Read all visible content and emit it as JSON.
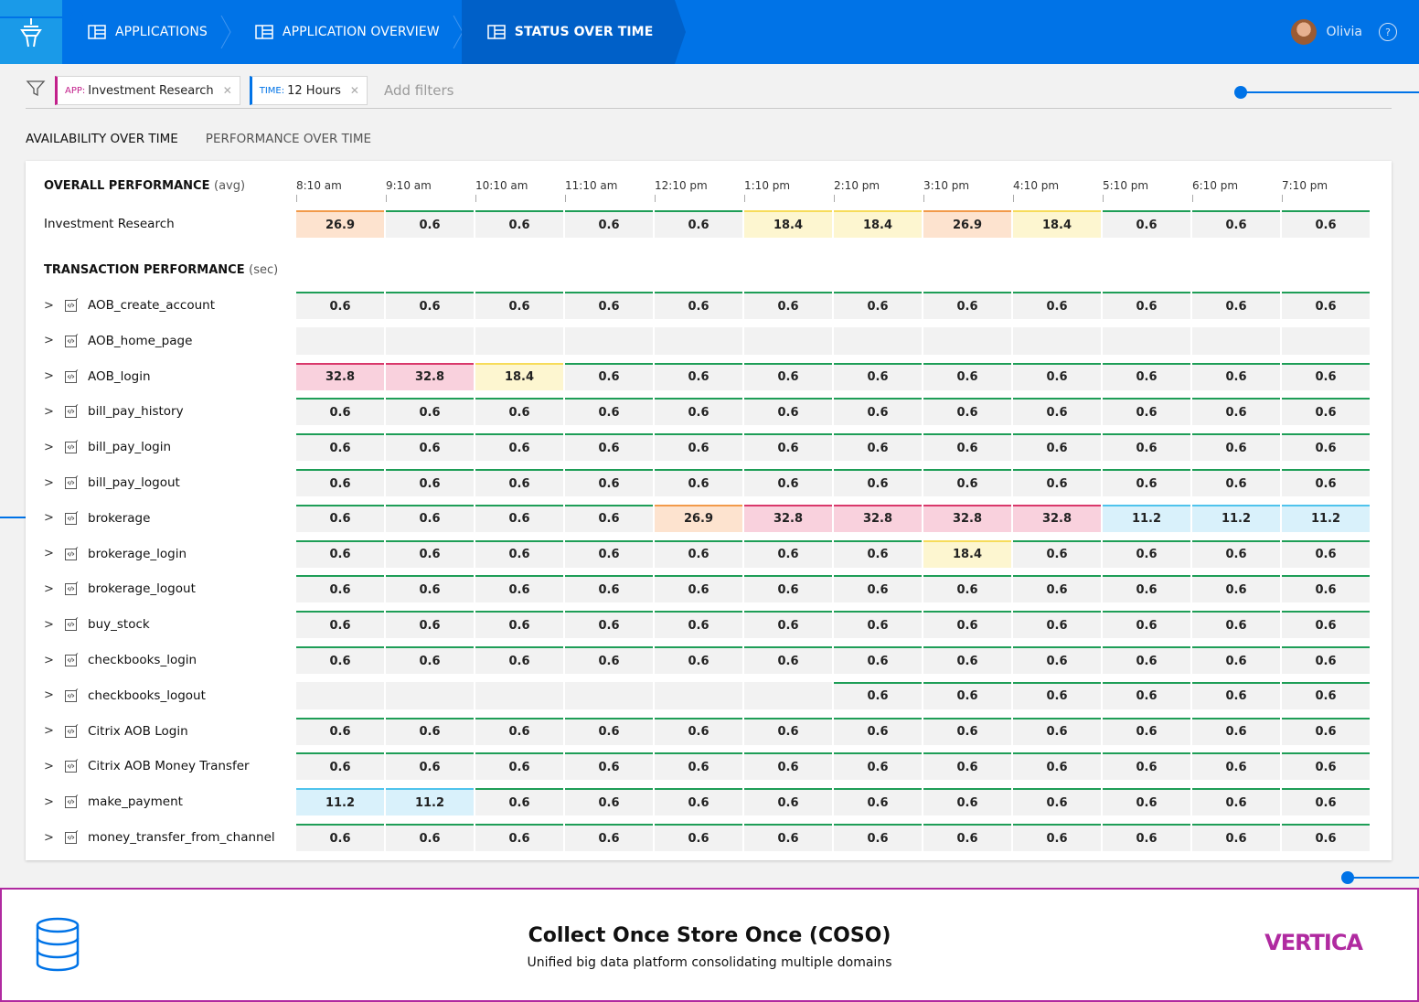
{
  "header": {
    "breadcrumbs": [
      "APPLICATIONS",
      "APPLICATION OVERVIEW",
      "STATUS OVER TIME"
    ],
    "user_name": "Olivia",
    "help_glyph": "?"
  },
  "filters": {
    "chips": [
      {
        "key": "APP:",
        "value": "Investment Research"
      },
      {
        "key": "TIME:",
        "value": "12 Hours"
      }
    ],
    "add_placeholder": "Add filters"
  },
  "tabs": [
    "AVAILABILITY OVER TIME",
    "PERFORMANCE OVER TIME"
  ],
  "overall": {
    "title": "OVERALL PERFORMANCE",
    "suffix": "(avg)",
    "rows": [
      {
        "name": "Investment Research",
        "values": [
          "26.9",
          "0.6",
          "0.6",
          "0.6",
          "0.6",
          "18.4",
          "18.4",
          "26.9",
          "18.4",
          "0.6",
          "0.6",
          "0.6"
        ]
      }
    ]
  },
  "time_labels": [
    "8:10 am",
    "9:10 am",
    "10:10 am",
    "11:10 am",
    "12:10 pm",
    "1:10 pm",
    "2:10 pm",
    "3:10 pm",
    "4:10 pm",
    "5:10 pm",
    "6:10 pm",
    "7:10 pm"
  ],
  "transactions": {
    "title": "TRANSACTION PERFORMANCE",
    "suffix": "(sec)",
    "rows": [
      {
        "name": "AOB_create_account",
        "values": [
          "0.6",
          "0.6",
          "0.6",
          "0.6",
          "0.6",
          "0.6",
          "0.6",
          "0.6",
          "0.6",
          "0.6",
          "0.6",
          "0.6"
        ]
      },
      {
        "name": "AOB_home_page",
        "values": [
          "",
          "",
          "",
          "",
          "",
          "",
          "",
          "",
          "",
          "",
          "",
          ""
        ]
      },
      {
        "name": "AOB_login",
        "values": [
          "32.8",
          "32.8",
          "18.4",
          "0.6",
          "0.6",
          "0.6",
          "0.6",
          "0.6",
          "0.6",
          "0.6",
          "0.6",
          "0.6"
        ]
      },
      {
        "name": "bill_pay_history",
        "values": [
          "0.6",
          "0.6",
          "0.6",
          "0.6",
          "0.6",
          "0.6",
          "0.6",
          "0.6",
          "0.6",
          "0.6",
          "0.6",
          "0.6"
        ]
      },
      {
        "name": "bill_pay_login",
        "values": [
          "0.6",
          "0.6",
          "0.6",
          "0.6",
          "0.6",
          "0.6",
          "0.6",
          "0.6",
          "0.6",
          "0.6",
          "0.6",
          "0.6"
        ]
      },
      {
        "name": "bill_pay_logout",
        "values": [
          "0.6",
          "0.6",
          "0.6",
          "0.6",
          "0.6",
          "0.6",
          "0.6",
          "0.6",
          "0.6",
          "0.6",
          "0.6",
          "0.6"
        ]
      },
      {
        "name": "brokerage",
        "values": [
          "0.6",
          "0.6",
          "0.6",
          "0.6",
          "26.9",
          "32.8",
          "32.8",
          "32.8",
          "32.8",
          "11.2",
          "11.2",
          "11.2"
        ]
      },
      {
        "name": "brokerage_login",
        "values": [
          "0.6",
          "0.6",
          "0.6",
          "0.6",
          "0.6",
          "0.6",
          "0.6",
          "18.4",
          "0.6",
          "0.6",
          "0.6",
          "0.6"
        ]
      },
      {
        "name": "brokerage_logout",
        "values": [
          "0.6",
          "0.6",
          "0.6",
          "0.6",
          "0.6",
          "0.6",
          "0.6",
          "0.6",
          "0.6",
          "0.6",
          "0.6",
          "0.6"
        ]
      },
      {
        "name": "buy_stock",
        "values": [
          "0.6",
          "0.6",
          "0.6",
          "0.6",
          "0.6",
          "0.6",
          "0.6",
          "0.6",
          "0.6",
          "0.6",
          "0.6",
          "0.6"
        ]
      },
      {
        "name": "checkbooks_login",
        "values": [
          "0.6",
          "0.6",
          "0.6",
          "0.6",
          "0.6",
          "0.6",
          "0.6",
          "0.6",
          "0.6",
          "0.6",
          "0.6",
          "0.6"
        ]
      },
      {
        "name": "checkbooks_logout",
        "values": [
          "",
          "",
          "",
          "",
          "",
          "",
          "0.6",
          "0.6",
          "0.6",
          "0.6",
          "0.6",
          "0.6"
        ]
      },
      {
        "name": "Citrix AOB Login",
        "values": [
          "0.6",
          "0.6",
          "0.6",
          "0.6",
          "0.6",
          "0.6",
          "0.6",
          "0.6",
          "0.6",
          "0.6",
          "0.6",
          "0.6"
        ]
      },
      {
        "name": "Citrix AOB Money Transfer",
        "values": [
          "0.6",
          "0.6",
          "0.6",
          "0.6",
          "0.6",
          "0.6",
          "0.6",
          "0.6",
          "0.6",
          "0.6",
          "0.6",
          "0.6"
        ]
      },
      {
        "name": "make_payment",
        "values": [
          "11.2",
          "11.2",
          "0.6",
          "0.6",
          "0.6",
          "0.6",
          "0.6",
          "0.6",
          "0.6",
          "0.6",
          "0.6",
          "0.6"
        ]
      },
      {
        "name": "money_transfer_from_channel",
        "values": [
          "0.6",
          "0.6",
          "0.6",
          "0.6",
          "0.6",
          "0.6",
          "0.6",
          "0.6",
          "0.6",
          "0.6",
          "0.6",
          "0.6"
        ]
      }
    ]
  },
  "status_colors": {
    "0.6": {
      "bg": "#f2f2f2",
      "line": "#1e9e57"
    },
    "11.2": {
      "bg": "#d9f1fb",
      "line": "#4fc3ec"
    },
    "18.4": {
      "bg": "#fdf6d0",
      "line": "#f7dc5a"
    },
    "26.9": {
      "bg": "#fde3cf",
      "line": "#f29a4a"
    },
    "32.8": {
      "bg": "#f9d1dd",
      "line": "#d9386b"
    }
  },
  "footer": {
    "title": "Collect Once Store Once (COSO)",
    "subtitle": "Unified big data platform consolidating multiple domains",
    "logo_text": "VERTICA"
  },
  "colors": {
    "brand": "#0073e7",
    "accent": "#b02aa0"
  }
}
